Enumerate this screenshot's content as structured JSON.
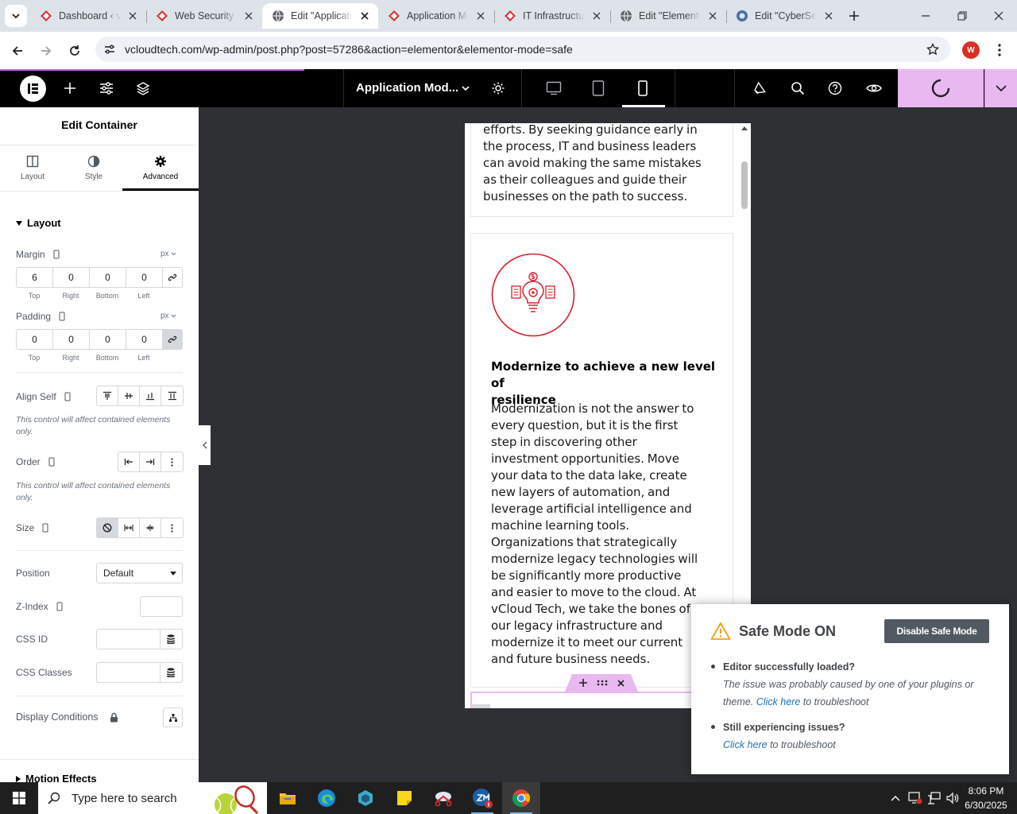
{
  "browser": {
    "tabs": [
      {
        "title": "Dashboard ‹ vCloud Tech",
        "icon": "diamond-favicon",
        "active": false
      },
      {
        "title": "Web Security",
        "icon": "diamond-favicon",
        "active": false
      },
      {
        "title": "Edit \"Application Modernization\"",
        "icon": "globe-favicon",
        "active": true
      },
      {
        "title": "Application Modernization",
        "icon": "diamond-favicon",
        "active": false
      },
      {
        "title": "IT Infrastructure",
        "icon": "diamond-favicon",
        "active": false
      },
      {
        "title": "Edit \"Elementor\"",
        "icon": "globe-favicon",
        "active": false
      },
      {
        "title": "Edit \"CyberSecurity\"",
        "icon": "browser-favicon",
        "active": false
      }
    ],
    "url": "vcloudtech.com/wp-admin/post.php?post=57286&action=elementor&elementor-mode=safe",
    "profile_initial": "W"
  },
  "elementor": {
    "document_title": "Application Mod...",
    "active_device": "mobile",
    "accent": "#eab8f1"
  },
  "panel": {
    "title": "Edit Container",
    "tabs": [
      "Layout",
      "Style",
      "Advanced"
    ],
    "active_tab": "Advanced",
    "layout_section": "Layout",
    "margin": {
      "label": "Margin",
      "unit": "px",
      "top": "6",
      "right": "0",
      "bottom": "0",
      "left": "0"
    },
    "padding": {
      "label": "Padding",
      "unit": "px",
      "top": "0",
      "right": "0",
      "bottom": "0",
      "left": "0"
    },
    "dim_labels": [
      "Top",
      "Right",
      "Bottom",
      "Left"
    ],
    "align_self": "Align Self",
    "hint": "This control will affect contained elements only.",
    "order": "Order",
    "size": "Size",
    "position": {
      "label": "Position",
      "value": "Default"
    },
    "z_index": "Z-Index",
    "css_id": "CSS ID",
    "css_classes": "CSS Classes",
    "display_conditions": "Display Conditions",
    "motion_effects": "Motion Effects"
  },
  "preview": {
    "intro_lines": [
      "efforts. By seeking guidance early in",
      "the process, IT and business leaders",
      "can avoid making the same mistakes",
      "as their colleagues and guide their",
      "businesses on the path to success."
    ],
    "heading_lines": [
      "Modernize to achieve a new level of",
      "resilience"
    ],
    "body_lines": [
      "Modernization is not the answer to",
      "every question, but it is the first",
      "step in discovering other",
      "investment opportunities. Move",
      "your data to the data lake, create",
      "new layers of automation, and",
      "leverage artificial intelligence and",
      "machine learning tools.",
      "Organizations that strategically",
      "modernize legacy technologies will",
      "be significantly more productive",
      "and easier to move to the cloud. At",
      "vCloud Tech, we take the bones of",
      "our legacy infrastructure and",
      "modernize it to meet our current",
      "and future business needs."
    ],
    "icon_color": "#d4202c"
  },
  "safe_mode": {
    "title": "Safe Mode ON",
    "button": "Disable Safe Mode",
    "q1": "Editor successfully loaded?",
    "a1_lines": [
      "The issue was probably caused by one of your plugins or"
    ],
    "a1_prefix": "theme.",
    "a1_link": "Click here",
    "a1_suffix": "to troubleshoot",
    "q2": "Still experiencing issues?",
    "a2_link": "Click here",
    "a2_suffix": "to troubleshoot"
  },
  "taskbar": {
    "search_placeholder": "Type here to search",
    "time": "8:06 PM",
    "date": "6/30/2025"
  }
}
